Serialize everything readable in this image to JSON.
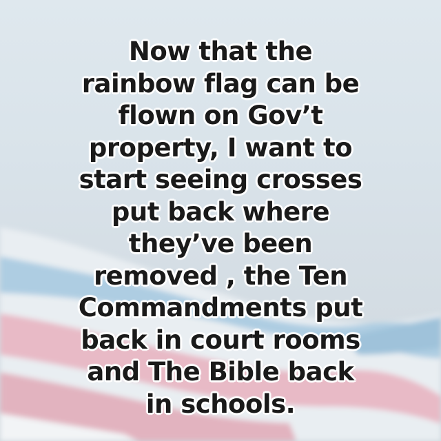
{
  "post": {
    "lines": [
      "Now that the",
      "rainbow flag can be",
      "flown on Gov’t",
      "property, I want to",
      "start seeing crosses",
      "put back where",
      "they’ve been",
      "removed , the Ten",
      "Commandments put",
      "back in court rooms",
      "and The Bible back",
      "in schools."
    ]
  },
  "colors": {
    "text": "#1a1a1a",
    "text_outline": "#ffffff",
    "background": "#dbe4ea",
    "flag_pink": "#e7b9c4",
    "flag_blue": "#a9cbe0"
  }
}
